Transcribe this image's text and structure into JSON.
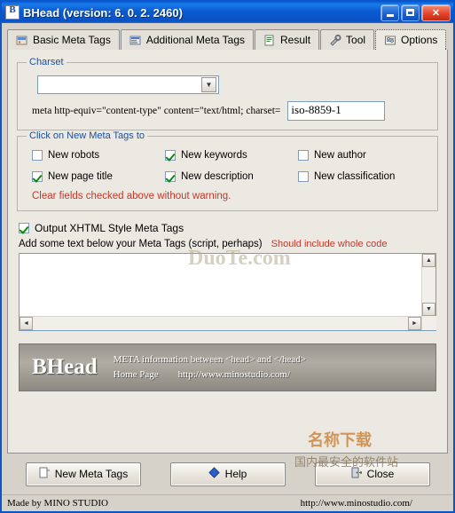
{
  "window": {
    "title": "BHead (version:  6. 0. 2. 2460)",
    "icon": "app-icon",
    "buttons": {
      "minimize": "minimize",
      "maximize": "maximize",
      "close": "close"
    }
  },
  "tabs": [
    {
      "label": "Basic Meta Tags",
      "icon": "tag-icon",
      "selected": false
    },
    {
      "label": "Additional Meta Tags",
      "icon": "tags-icon",
      "selected": false
    },
    {
      "label": "Result",
      "icon": "document-icon",
      "selected": false
    },
    {
      "label": "Tool",
      "icon": "wrench-icon",
      "selected": false
    },
    {
      "label": "Options",
      "icon": "options-icon",
      "selected": true
    }
  ],
  "charset": {
    "legend": "Charset",
    "combo_value": "",
    "combo_arrow": "chevron-down-icon",
    "meta_label": "meta http-equiv=\"content-type\" content=\"text/html; charset=",
    "value": "iso-8859-1"
  },
  "new_meta": {
    "legend": "Click on New Meta Tags to",
    "items": [
      {
        "label": "New robots",
        "checked": false
      },
      {
        "label": "New keywords",
        "checked": true
      },
      {
        "label": "New author",
        "checked": false
      },
      {
        "label": "New page title",
        "checked": true
      },
      {
        "label": "New description",
        "checked": true
      },
      {
        "label": "New classification",
        "checked": false
      }
    ],
    "warning": "Clear fields checked above without warning."
  },
  "xhtml": {
    "label": "Output XHTML Style Meta Tags",
    "checked": true
  },
  "script_area": {
    "label": "Add some text below your Meta Tags (script, perhaps)",
    "hint": "Should include whole code",
    "value": ""
  },
  "banner": {
    "logo": "BHead",
    "line1": "META information between <head> and </head>",
    "line2_left": "Home Page",
    "line2_right": "http://www.minostudio.com/"
  },
  "watermarks": {
    "site": "DuoTe.com",
    "cn_top": "名称下载",
    "cn_bottom": "国内最安全的软件站"
  },
  "buttons": [
    {
      "label": "New Meta Tags",
      "icon": "page-icon"
    },
    {
      "label": "Help",
      "icon": "diamond-icon"
    },
    {
      "label": "Close",
      "icon": "door-icon"
    }
  ],
  "statusbar": {
    "left": "Made by MINO STUDIO",
    "right": "http://www.minostudio.com/"
  }
}
